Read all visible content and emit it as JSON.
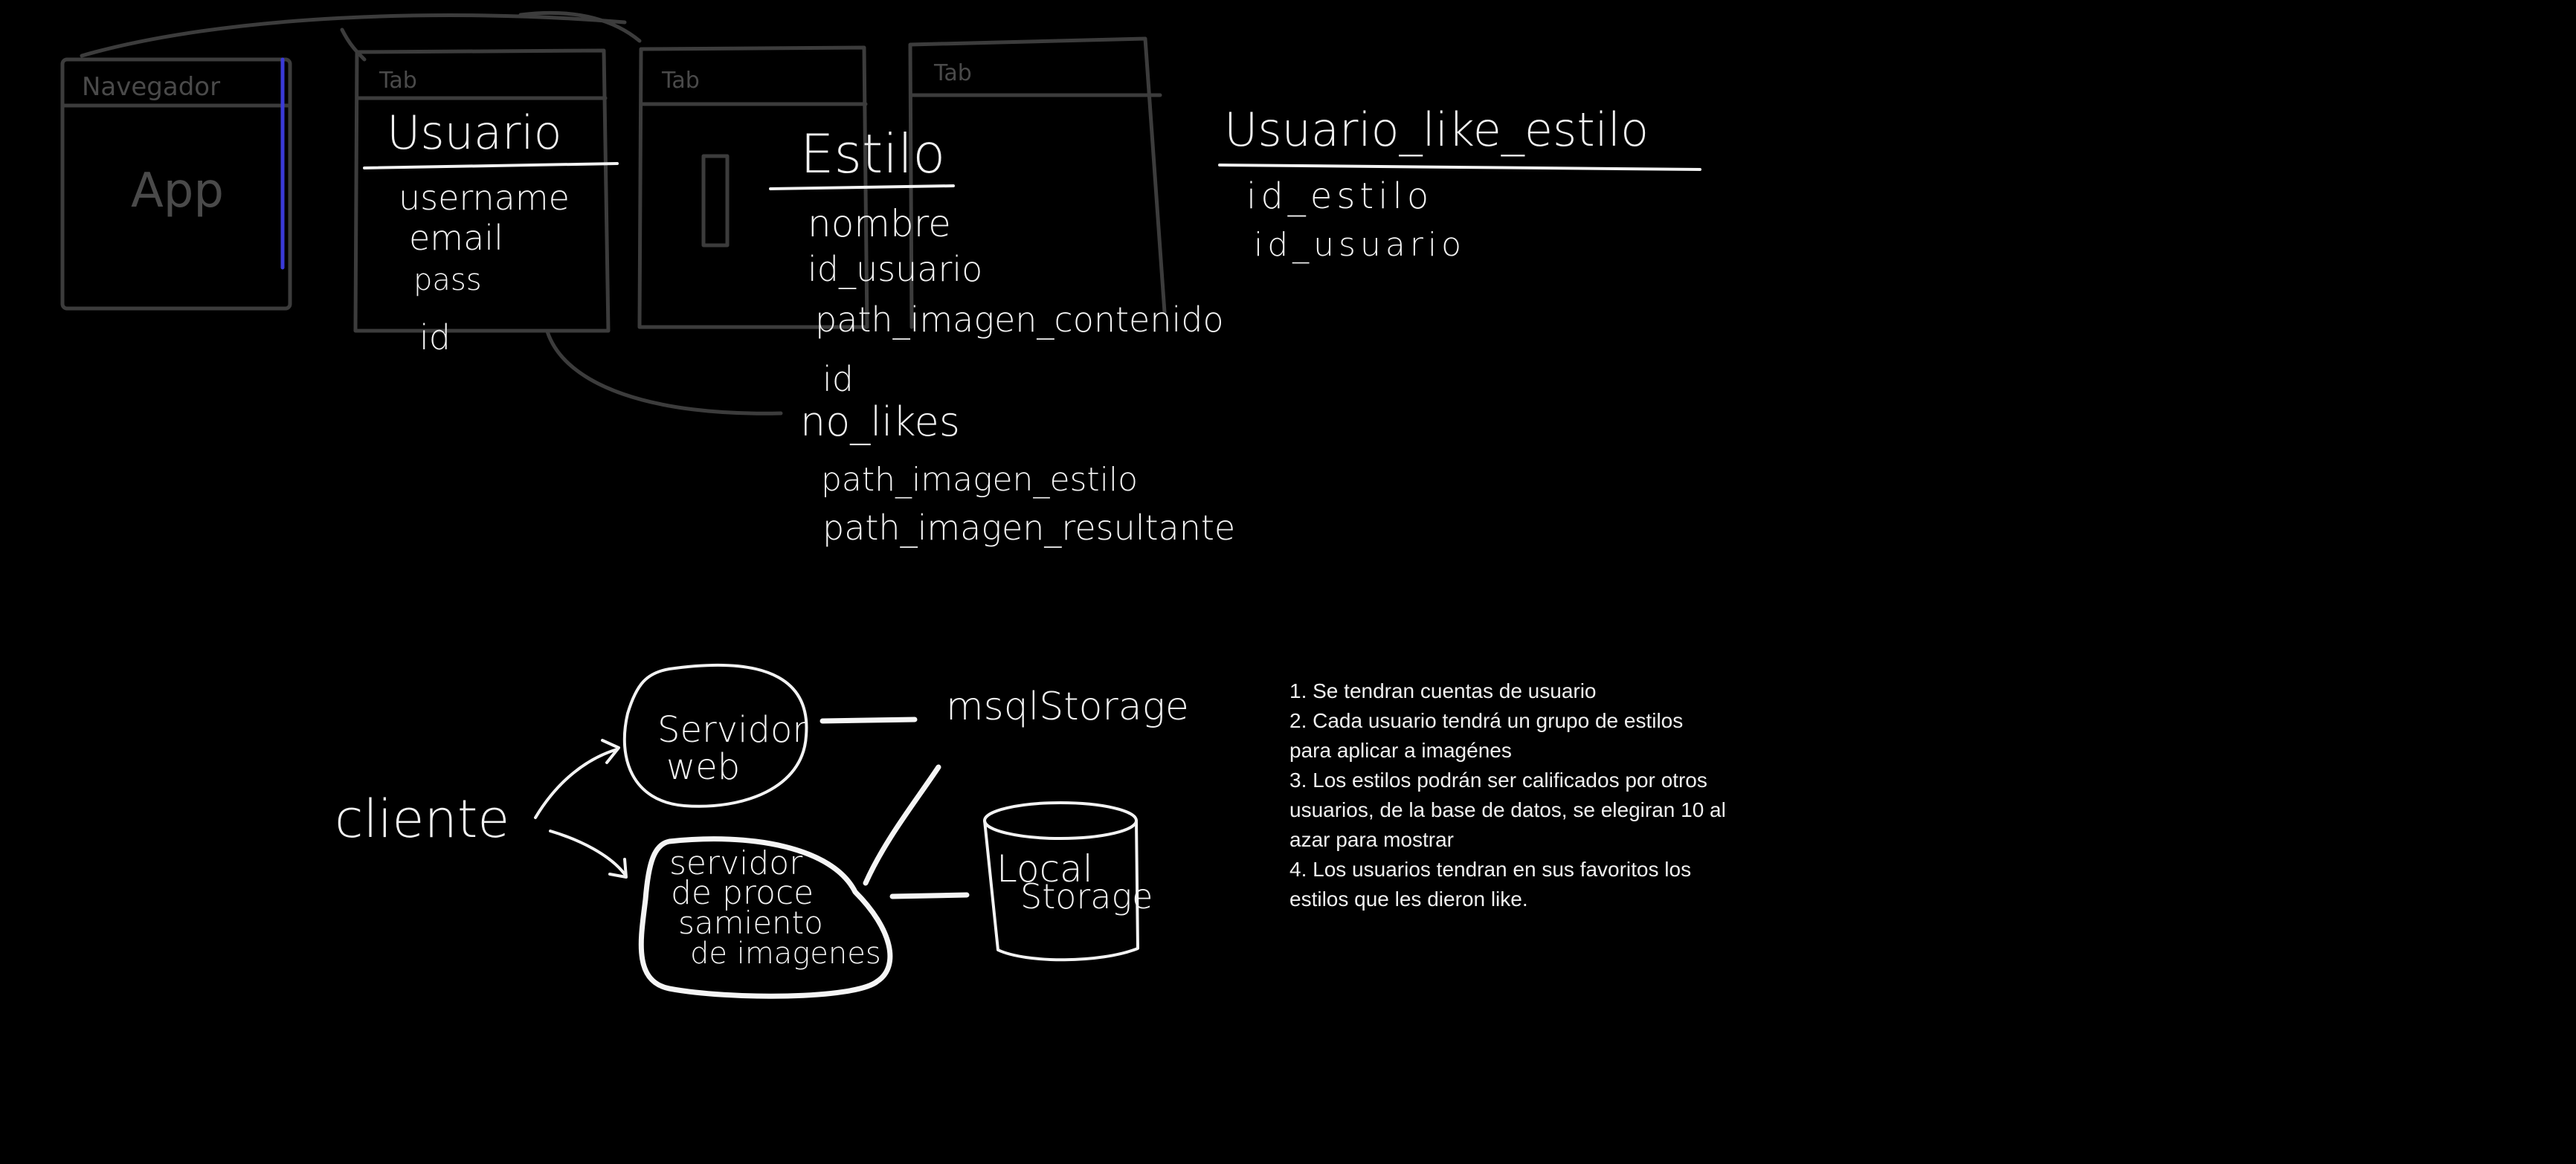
{
  "frames": [
    {
      "title": "Navegador",
      "content": "App"
    },
    {
      "title": "Tab",
      "content": ""
    },
    {
      "title": "Tab",
      "content": ""
    },
    {
      "title": "Tab",
      "content": ""
    }
  ],
  "entities": {
    "usuario": {
      "name": "Usuario",
      "fields": [
        "username",
        "email",
        "pass",
        "id"
      ]
    },
    "estilo": {
      "name": "Estilo",
      "fields": [
        "nombre",
        "id_usuario",
        "path_imagen_contenido",
        "id",
        "no_likes",
        "path_imagen_estilo",
        "path_imagen_resultante"
      ]
    },
    "usuario_like_estilo": {
      "name": "Usuario_like_estilo",
      "fields": [
        "id_estilo",
        "id_usuario"
      ]
    }
  },
  "architecture": {
    "client": "cliente",
    "web_server": [
      "Servidor",
      "web"
    ],
    "processing_server": [
      "servidor",
      "de proce",
      "samiento",
      "de imagenes"
    ],
    "sql_storage": "msqlStorage",
    "local_storage": [
      "Local",
      "Storage"
    ]
  },
  "notes": [
    "1. Se tendran cuentas de usuario",
    "2. Cada usuario tendrá un grupo de estilos",
    "para aplicar a imagénes",
    "3. Los estilos podrán ser calificados por otros",
    "usuarios, de la base de datos, se elegiran 10 al",
    "azar para mostrar",
    "4. Los usuarios tendran en sus favoritos los",
    "estilos que les dieron like."
  ],
  "colors": {
    "background": "#000000",
    "ink": "#f2f2f2",
    "dim_ink": "#3c3c3c",
    "highlight": "#3a3ad8"
  }
}
